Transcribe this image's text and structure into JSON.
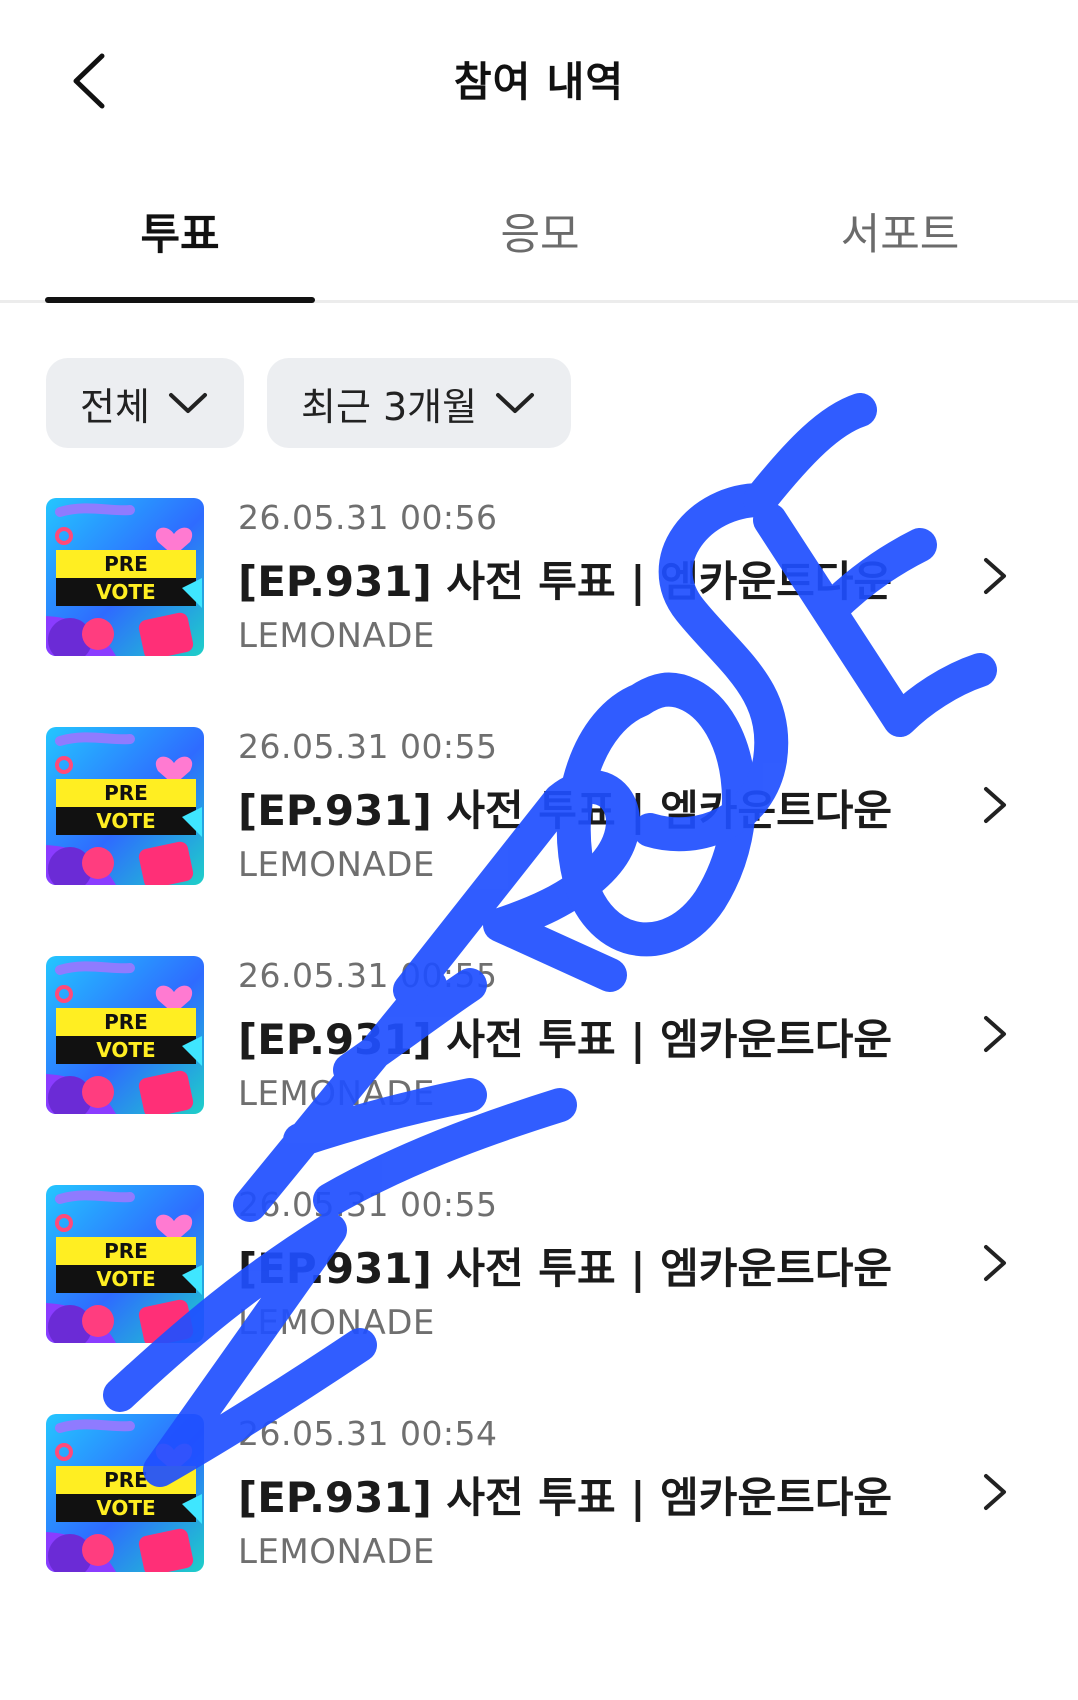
{
  "header": {
    "title": "참여 내역",
    "back_icon": "chevron-left-icon"
  },
  "tabs": [
    {
      "label": "투표",
      "active": true
    },
    {
      "label": "응모",
      "active": false
    },
    {
      "label": "서포트",
      "active": false
    }
  ],
  "filters": {
    "category": {
      "label": "전체",
      "icon": "chevron-down-icon"
    },
    "period": {
      "label": "최근 3개월",
      "icon": "chevron-down-icon"
    }
  },
  "items": [
    {
      "date": "26.05.31 00:56",
      "title": "[EP.931] 사전 투표 | 엠카운트다운",
      "subtitle": "LEMONADE",
      "thumb_line1": "PRE",
      "thumb_line2": "VOTE"
    },
    {
      "date": "26.05.31 00:55",
      "title": "[EP.931] 사전 투표 | 엠카운트다운",
      "subtitle": "LEMONADE",
      "thumb_line1": "PRE",
      "thumb_line2": "VOTE"
    },
    {
      "date": "26.05.31 00:55",
      "title": "[EP.931] 사전 투표 | 엠카운트다운",
      "subtitle": "LEMONADE",
      "thumb_line1": "PRE",
      "thumb_line2": "VOTE"
    },
    {
      "date": "26.05.31 00:55",
      "title": "[EP.931] 사전 투표 | 엠카운트다운",
      "subtitle": "LEMONADE",
      "thumb_line1": "PRE",
      "thumb_line2": "VOTE"
    },
    {
      "date": "26.05.31 00:54",
      "title": "[EP.931] 사전 투표 | 엠카운트다운",
      "subtitle": "LEMONADE",
      "thumb_line1": "PRE",
      "thumb_line2": "VOTE"
    }
  ],
  "watermark": {
    "text": "ZEROSE",
    "color": "#1f4fff"
  },
  "colors": {
    "active_tab": "#111111",
    "inactive_tab": "#6b6b6b",
    "filter_bg": "#eceef1",
    "meta_text": "#6f6f6f"
  }
}
